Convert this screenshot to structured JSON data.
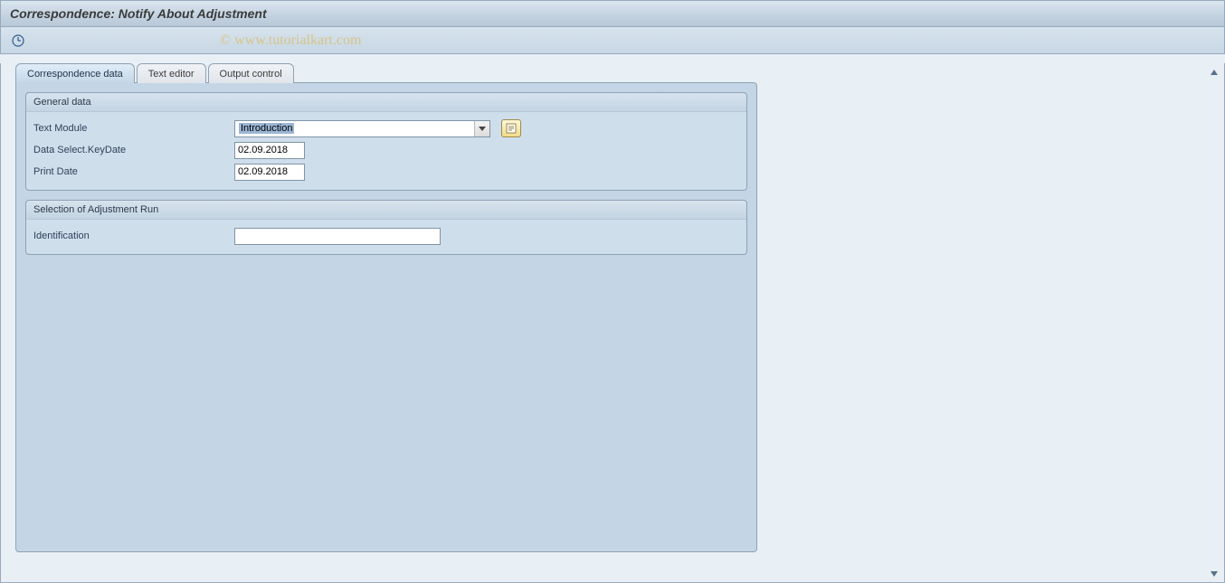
{
  "title": "Correspondence: Notify About Adjustment",
  "watermark": "© www.tutorialkart.com",
  "tabs": [
    {
      "label": "Correspondence data",
      "active": true
    },
    {
      "label": "Text editor",
      "active": false
    },
    {
      "label": "Output control",
      "active": false
    }
  ],
  "groups": {
    "general": {
      "title": "General data",
      "fields": {
        "text_module": {
          "label": "Text Module",
          "value": "Introduction"
        },
        "keydate": {
          "label": "Data Select.KeyDate",
          "value": "02.09.2018"
        },
        "print_date": {
          "label": "Print Date",
          "value": "02.09.2018"
        }
      }
    },
    "selection": {
      "title": "Selection of Adjustment Run",
      "fields": {
        "identification": {
          "label": "Identification",
          "value": ""
        }
      }
    }
  }
}
